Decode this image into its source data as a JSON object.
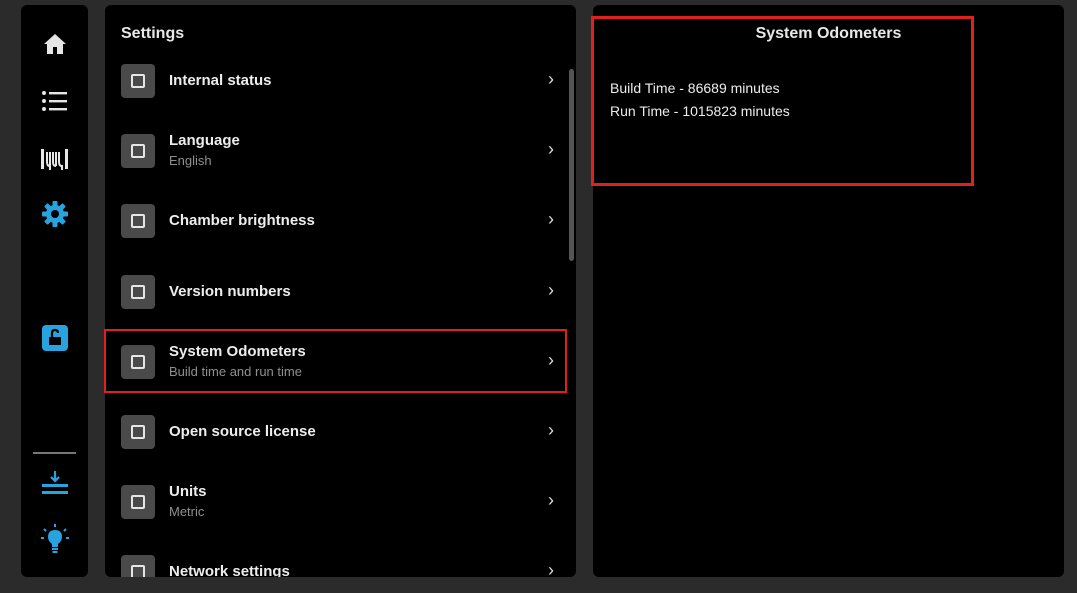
{
  "nav": {
    "items": [
      {
        "icon": "home-icon",
        "active": false
      },
      {
        "icon": "list-icon",
        "active": false
      },
      {
        "icon": "filament-icon",
        "active": false
      },
      {
        "icon": "gear-icon",
        "active": true
      },
      {
        "icon": "unlock-icon",
        "active": true
      },
      {
        "icon": "download-tray-icon",
        "active": true
      },
      {
        "icon": "light-bulb-icon",
        "active": true
      }
    ],
    "accent_color": "#29a3e0"
  },
  "settings": {
    "title": "Settings",
    "items": [
      {
        "label": "Internal status",
        "sublabel": ""
      },
      {
        "label": "Language",
        "sublabel": "English"
      },
      {
        "label": "Chamber brightness",
        "sublabel": ""
      },
      {
        "label": "Version numbers",
        "sublabel": ""
      },
      {
        "label": "System Odometers",
        "sublabel": "Build time and run time",
        "selected": true
      },
      {
        "label": "Open source license",
        "sublabel": ""
      },
      {
        "label": "Units",
        "sublabel": "Metric"
      },
      {
        "label": "Network settings",
        "sublabel": ""
      }
    ],
    "chevron": "›"
  },
  "detail": {
    "title": "System Odometers",
    "lines": [
      "Build Time - 86689 minutes",
      "Run Time - 1015823 minutes"
    ]
  },
  "highlight_color": "#e0201c"
}
